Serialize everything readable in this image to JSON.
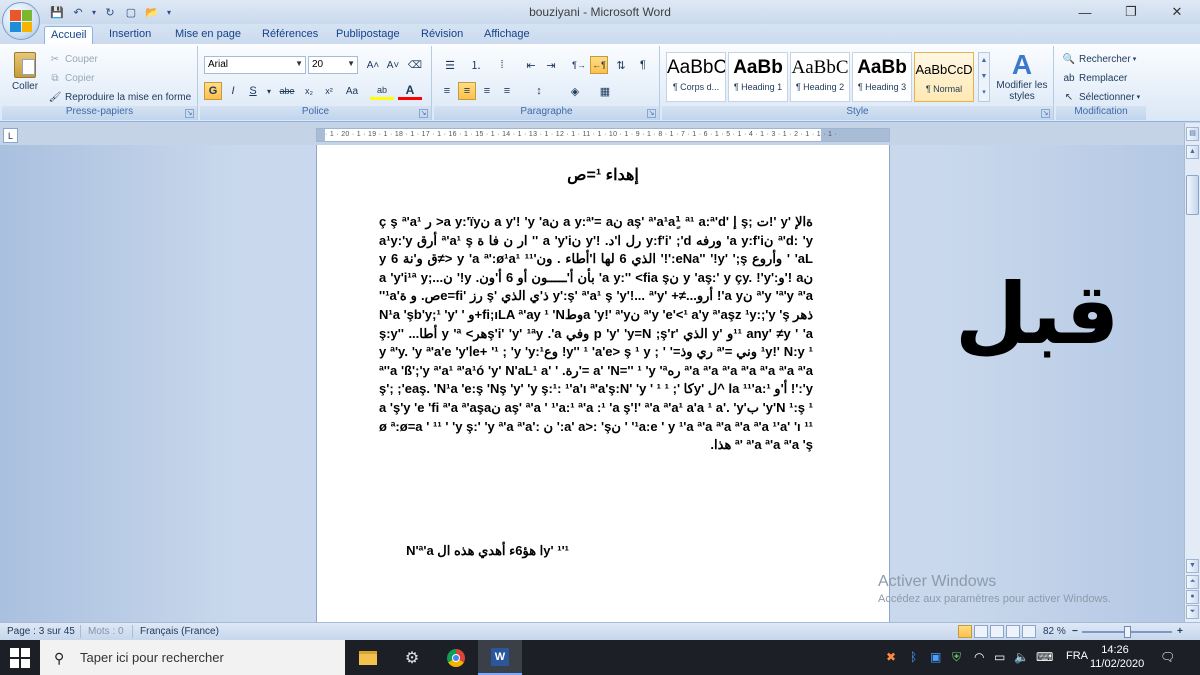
{
  "window": {
    "title": "bouziyani - Microsoft Word",
    "minimize": "—",
    "restore": "❐",
    "close": "✕"
  },
  "qat": {
    "save": "💾",
    "undo": "↶",
    "undo_dd": "▾",
    "redo": "↻",
    "new": "▢",
    "open": "📂",
    "more": "▾"
  },
  "tabs": [
    "Accueil",
    "Insertion",
    "Mise en page",
    "Références",
    "Publipostage",
    "Révision",
    "Affichage"
  ],
  "ribbon": {
    "clipboard": {
      "label": "Presse-papiers",
      "paste": "Coller",
      "cut": "Couper",
      "copy": "Copier",
      "format_painter": "Reproduire la mise en forme"
    },
    "font": {
      "label": "Police",
      "font_name": "Arial",
      "font_size": "20",
      "grow": "A˄",
      "shrink": "A˅",
      "clear": "⌫",
      "bold": "G",
      "italic": "I",
      "underline": "S",
      "strike": "abe",
      "subscript": "x₂",
      "superscript": "x²",
      "case": "Aa",
      "highlight": "ab",
      "color": "A"
    },
    "paragraph": {
      "label": "Paragraphe",
      "bullets": "☰",
      "numbering": "⒈",
      "multilevel": "⁞",
      "decrease_indent": "⇤",
      "increase_indent": "⇥",
      "sort": "⇅",
      "show_marks": "¶",
      "ltr": "¶→",
      "rtl": "←¶",
      "align_left": "≡",
      "align_center": "≡",
      "align_right": "≡",
      "justify": "≡",
      "spacing": "↕",
      "shading": "◈",
      "borders": "▦"
    },
    "styles": {
      "label": "Style",
      "items": [
        {
          "preview": "AaBbC",
          "name": "¶ Corps d..."
        },
        {
          "preview": "AaBb",
          "name": "¶ Heading 1"
        },
        {
          "preview": "AaBbC",
          "name": "¶ Heading 2"
        },
        {
          "preview": "AaBb",
          "name": "¶ Heading 3"
        },
        {
          "preview": "AaBbCcD",
          "name": "¶ Normal"
        }
      ],
      "change_styles": "Modifier les styles"
    },
    "editing": {
      "label": "Modification",
      "find": "Rechercher",
      "replace": "Remplacer",
      "select": "Sélectionner"
    }
  },
  "ruler": {
    "ticks": "· 1 · 20 · 1 · 19 · 1 · 18 · 1 · 17 · 1 · 16 · 1 · 15 · 1 · 14 · 1 · 13 · 1 · 12 · 1 · 11 · 1 · 10 · 1 · 9 · 1 · 8 · 1 · 7 · 1 · 6 · 1 · 5 · 1 · 4 · 1 · 3 · 1 · 2 · 1 · 1 · 1 ·"
  },
  "document": {
    "title": "إهداء ¹=ص",
    "body": "ةالإ 'y '!ت ;ş إ 'aş' ª'a¹a¹ٍ ª¹ a:ª'd نa y:ª'= a نa y'! 'y 'a نa y:'ïy< ر ç ş ª'a¹ ª'd: 'y نa y:f'i' ورفه y:f'i' ;'d رل ا'د. !'y نa 'y'i '' ار ن فا ة ª'a¹ ş أرق a¹y:'y 'aL ' وأروع eNa'' '!y' ';ş:'!' الذي 6 لها ا'أطاء . ون'¹¹ y 'a ª':ø¹a¹ <≠ق و'نة 6 y نa !'و:'y 'aş:' y çy. !'y نa y:'' <fia ş' بأن أ'ـــــون أو 6 أ'ون. y!' نa 'y'i¹ª y;... ª'y 'ª'y ª'a نa y'! أرو...≠+ 'y':ş' ª'a¹ ş 'y'!... ª'y ذ'ي الذي 'ş رز 'e=fiص. و ة'¹a'' ذهر ª'y 'e'<¹ a'y ª'aşz ¹y:;'y 'ş نa 'y!' ª'yوطfi;ıLA ª'ay ¹ 'N+و ' 'N¹a 'şb'y;¹ 'y ¹¹ any' ≠y ' 'aو 'y الذي 'p 'y' 'y=N ;ş'r وفي ş'i' 'y' ¹ªy .'aهر> y 'ª أطا... 'ş:y' ¹y!' N:y ¹ وني ='ª ري وذ=' ' ; y'' ¹ 'a'e> ş ¹ y! وعe+ '¹ ; 'y 'y:¹ا'y ª'y. 'y ª'a'e 'y ª'a ª'a ª'a ª'a ª'a ª'a ª'a رهa' 'N='' ¹ 'y 'ª ='رة. ª''a 'ß';'y ª'a¹ ª'a¹ó 'y' N'aL¹ a' ' 'y:'! أ'و ¹:la ¹¹'a ^ل 'yكا 'ş'; ;'eaş. 'N¹a 'e:ş 'Nş 'y' 'y ş:¹: ¹'a'ı ª'a'ş:N' 'y ' ¹ ¹ ; 'y'N ¹:ş ¹ ب'aş' ª'a ' ¹'a:¹ ª'a :¹ 'a ş'!' ª'a ª'a¹ a'a ¹ a'. 'y نa 'ş'y 'e 'fi ª'a ª'aşa '¹a:e ' y ¹'a ª'a ª'a ª'a ª'a ¹'a' 'ı ¹¹ ' نa' a>: 'ş:' ن :'ø ª:ø=a ' ¹¹ ' 'y ş:' 'y ª'a ª'a ª' ª'a ª'a ª'a 'ş هذا.",
    "ending": "¹'y' ¹ا هؤ6ء أهدي هذه ال N'ª'a"
  },
  "overlay": {
    "big_word": "قبل",
    "activate_title": "Activer Windows",
    "activate_sub": "Accédez aux paramètres pour activer Windows."
  },
  "status": {
    "page": "Page : 3 sur 45",
    "words": "Mots : 0",
    "language": "Français (France)",
    "zoom": "82 %",
    "zoom_minus": "−",
    "zoom_plus": "+"
  },
  "taskbar": {
    "search_placeholder": "Taper ici pour rechercher",
    "language": "FRA",
    "time": "14:26",
    "date": "11/02/2020"
  }
}
